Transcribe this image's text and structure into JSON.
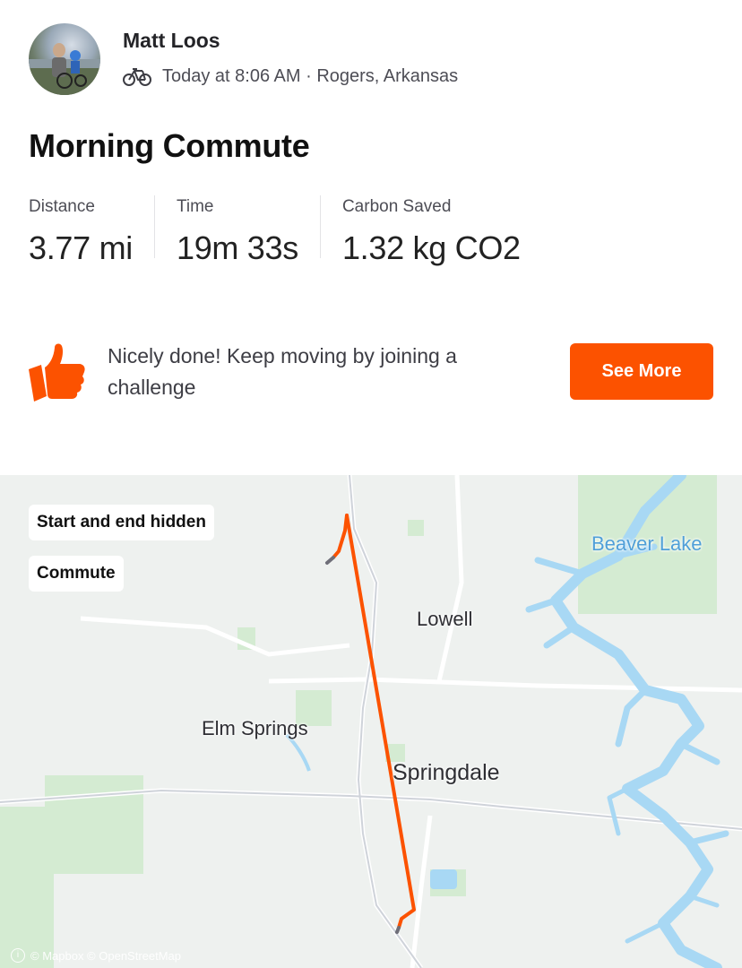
{
  "athlete": {
    "name": "Matt Loos",
    "meta": "Today at 8:06 AM · Rogers, Arkansas"
  },
  "activity": {
    "title": "Morning Commute"
  },
  "stats": [
    {
      "label": "Distance",
      "value": "3.77 mi"
    },
    {
      "label": "Time",
      "value": "19m 33s"
    },
    {
      "label": "Carbon Saved",
      "value": "1.32 kg CO2"
    }
  ],
  "promo": {
    "text": "Nicely done! Keep moving by joining a challenge",
    "button": "See More"
  },
  "map": {
    "tags": {
      "privacy": "Start and end hidden",
      "commute": "Commute"
    },
    "places": {
      "lowell": "Lowell",
      "elm_springs": "Elm Springs",
      "springdale": "Springdale",
      "beaver_lake": "Beaver Lake"
    },
    "attribution": "© Mapbox © OpenStreetMap",
    "info_glyph": "i"
  },
  "colors": {
    "accent": "#fc5200",
    "route": "#fc5200",
    "water": "#a8d8f4",
    "park": "#c9e6c6"
  },
  "icons": {
    "sport": "bike-icon",
    "kudos": "thumbs-up-icon"
  }
}
